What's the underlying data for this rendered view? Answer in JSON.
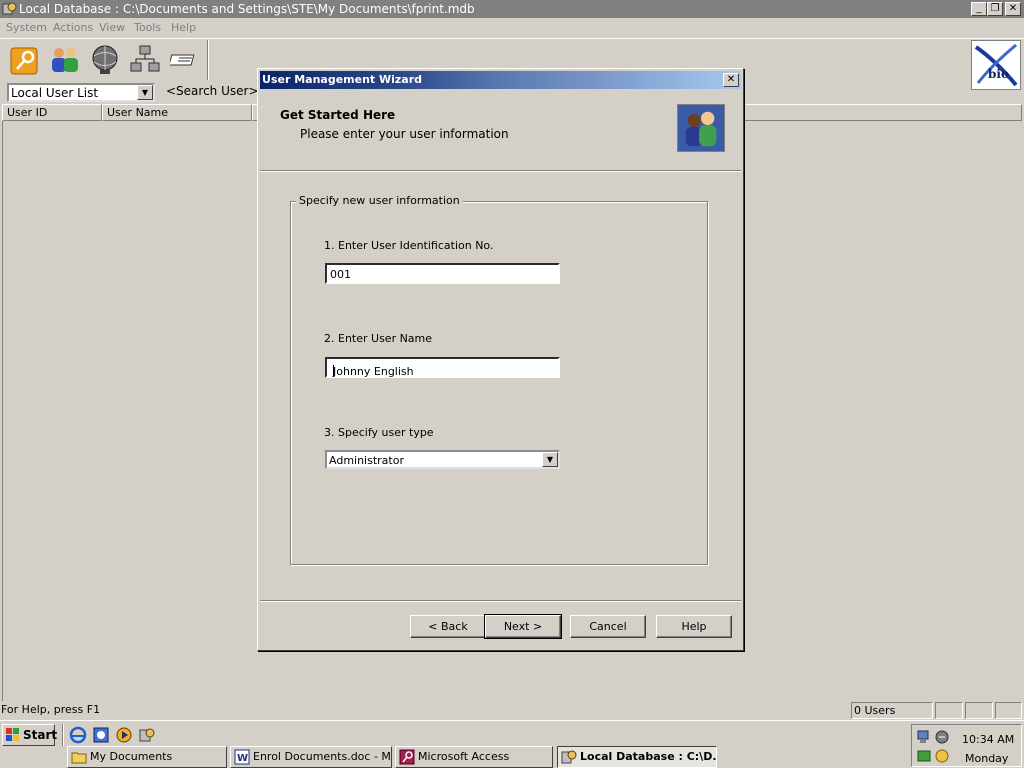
{
  "window": {
    "title": "Local Database : C:\\Documents and Settings\\STE\\My Documents\\fprint.mdb"
  },
  "menu": {
    "items": [
      "System",
      "Actions",
      "View",
      "Tools",
      "Help"
    ]
  },
  "toolbar": {
    "logo_text": "bio"
  },
  "user_list": {
    "combo_value": "Local User List",
    "search_label": "<Search User>",
    "columns": [
      "User ID",
      "User Name"
    ]
  },
  "status": {
    "help_text": "For Help, press F1",
    "user_count": "0 Users"
  },
  "dialog": {
    "title": "User Management Wizard",
    "heading": "Get Started Here",
    "subheading": "Please enter your user information",
    "group_label": "Specify new user information",
    "field1_label": "1. Enter User Identification No.",
    "field1_value": "001",
    "field2_label": "2. Enter User Name",
    "field2_value": "Johnny English",
    "field3_label": "3. Specify user type",
    "field3_value": "Administrator",
    "buttons": {
      "back": "< Back",
      "next": "Next >",
      "cancel": "Cancel",
      "help": "Help"
    }
  },
  "taskbar": {
    "start_label": "Start",
    "tasks": [
      {
        "label": "My Documents"
      },
      {
        "label": "Enrol Documents.doc - M..."
      },
      {
        "label": "Microsoft Access"
      },
      {
        "label": "Local Database : C:\\D..."
      }
    ],
    "clock": "10:34 AM",
    "day": "Monday"
  }
}
